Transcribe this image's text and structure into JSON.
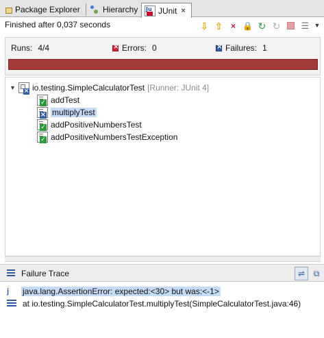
{
  "tabs": [
    {
      "label": "Package Explorer",
      "icon": "package-icon",
      "active": false
    },
    {
      "label": "Hierarchy",
      "icon": "hierarchy-icon",
      "active": false
    },
    {
      "label": "JUnit",
      "icon": "junit-icon",
      "active": true,
      "close": "×"
    }
  ],
  "status": {
    "finished": "Finished after 0,037 seconds"
  },
  "toolbar": {
    "icons": [
      "next-failure-icon",
      "previous-failure-icon",
      "show-failures-only-icon",
      "scroll-lock-icon",
      "rerun-icon",
      "rerun-failed-first-icon",
      "stop-icon",
      "test-run-history-icon",
      "view-menu-icon"
    ],
    "next_failure": "⇩",
    "previous_failure": "⇧",
    "failures_only": "×",
    "scroll_lock": "🔒",
    "rerun": "↻",
    "rerun_failed": "↻",
    "history": "☰",
    "menu_caret": "▼"
  },
  "counters": {
    "runs_label": "Runs:",
    "runs_value": "4/4",
    "errors_label": "Errors:",
    "errors_value": "0",
    "failures_label": "Failures:",
    "failures_value": "1",
    "progress_fraction": 1.0,
    "progress_color": "#a33a3a"
  },
  "tree": {
    "suite": {
      "twist": "▼",
      "name": "io.testing.SimpleCalculatorTest",
      "runner": "[Runner: JUnit 4]"
    },
    "tests": [
      {
        "name": "addTest",
        "status": "passed",
        "selected": false
      },
      {
        "name": "multiplyTest",
        "status": "failed",
        "selected": true
      },
      {
        "name": "addPositiveNumbersTest",
        "status": "passed",
        "selected": false
      },
      {
        "name": "addPositiveNumbersTestException",
        "status": "passed",
        "selected": false
      }
    ]
  },
  "failure_trace": {
    "title": "Failure Trace",
    "filter_icon": "⇌",
    "compare_icon": "⧉",
    "lines": [
      {
        "text": "java.lang.AssertionError: expected:<30> but was:<-1>",
        "selected": true,
        "icon": "j"
      },
      {
        "text": "at io.testing.SimpleCalculatorTest.multiplyTest(SimpleCalculatorTest.java:46)",
        "selected": false,
        "icon": "stack-frame-icon"
      }
    ]
  }
}
